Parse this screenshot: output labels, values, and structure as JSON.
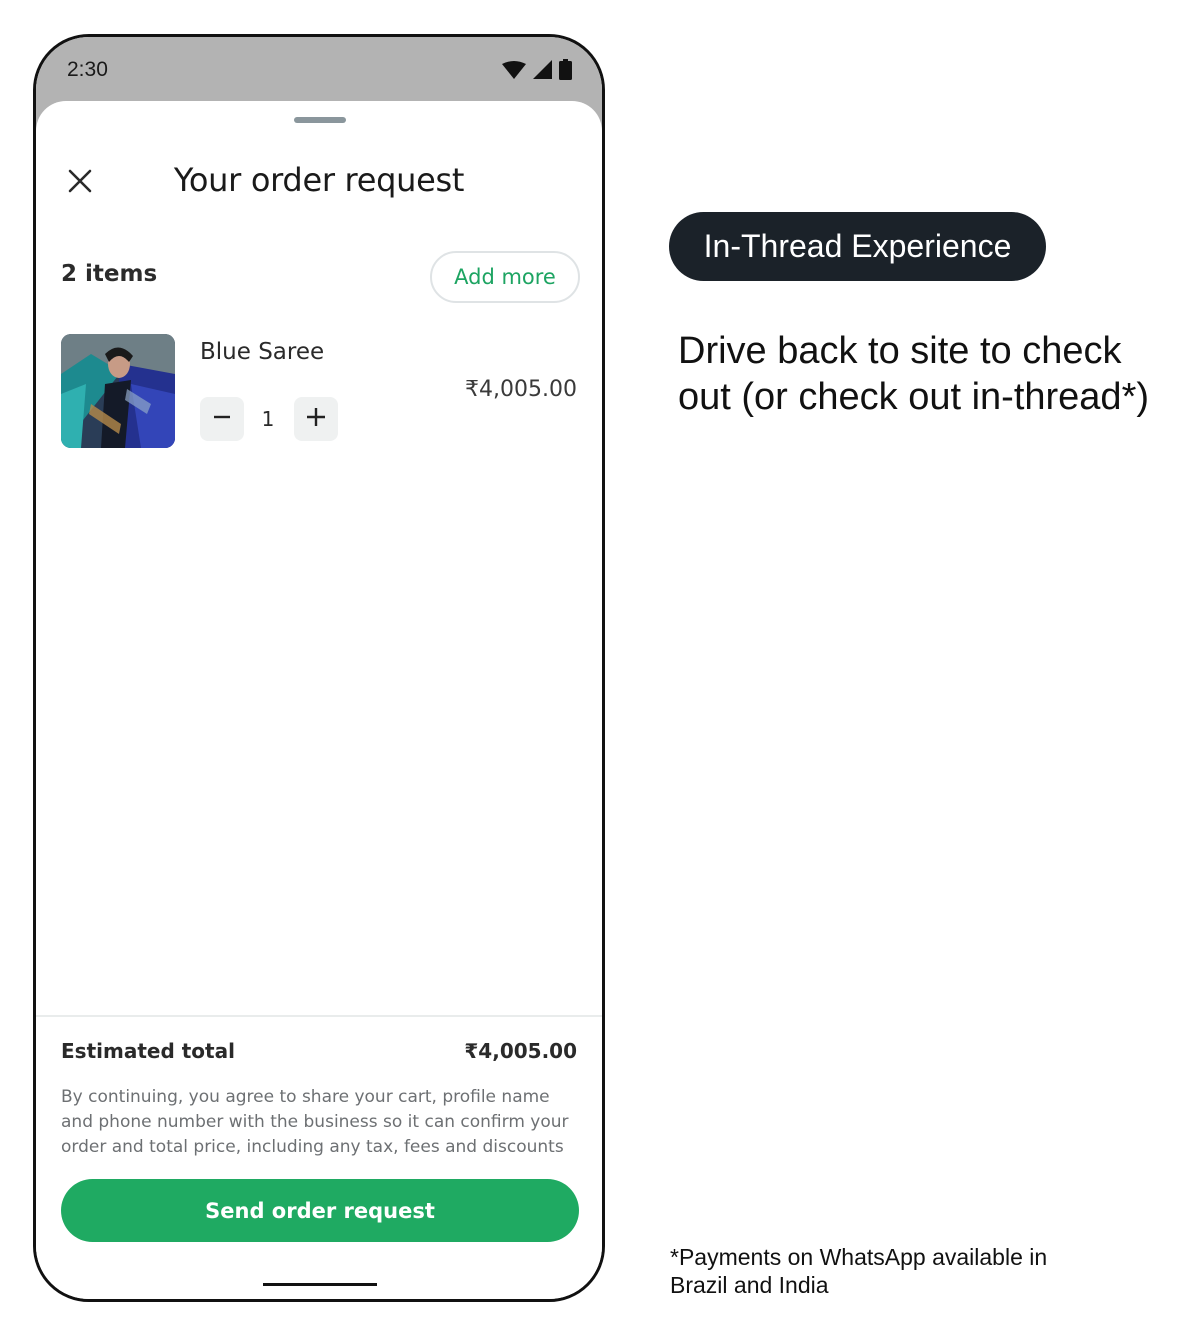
{
  "status_bar": {
    "time": "2:30",
    "icons": [
      "wifi-icon",
      "cellular-signal-icon",
      "battery-icon"
    ]
  },
  "sheet": {
    "title": "Your order request",
    "close_icon": "close-icon",
    "items_count": "2 items",
    "add_more_label": "Add more",
    "accent_color": "#1faa62"
  },
  "cart": {
    "items": [
      {
        "name": "Blue Saree",
        "price": "₹4,005.00",
        "quantity": "1",
        "decrement_symbol": "−",
        "increment_symbol": "+"
      }
    ]
  },
  "footer": {
    "estimated_total_label": "Estimated total",
    "estimated_total_value": "₹4,005.00",
    "disclaimer": "By continuing, you agree to share your cart, profile name and phone number with the business so it can confirm your order and total price, including any tax, fees and discounts",
    "send_button_label": "Send order request"
  },
  "annotation": {
    "badge": "In-Thread Experience",
    "caption": "Drive back to site to check out (or check out in-thread*)",
    "footnote": "*Payments on WhatsApp available in Brazil and India"
  }
}
